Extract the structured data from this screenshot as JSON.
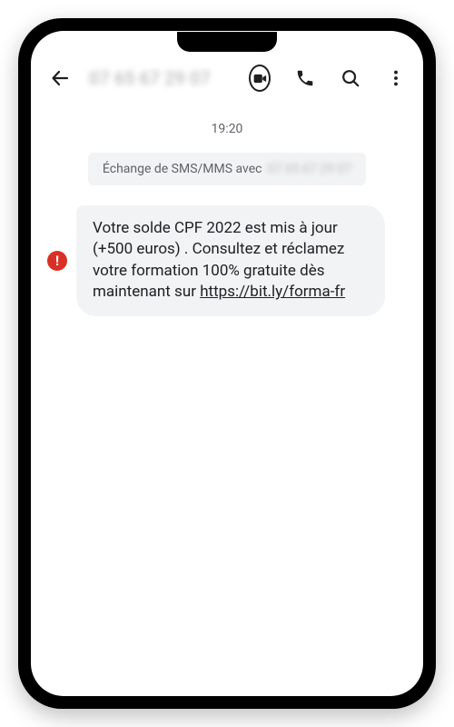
{
  "header": {
    "contact_blurred": "07 65 67 29 07"
  },
  "conversation": {
    "timestamp": "19:20",
    "exchange_prefix": "Échange de SMS/MMS avec",
    "exchange_number_blurred": "07 65 67 29 07"
  },
  "message": {
    "warning_glyph": "!",
    "body": "Votre solde CPF 2022 est mis à jour (+500 euros) . Consultez et réclamez votre formation 100% gratuite dès maintenant sur ",
    "link_text": "https://bit.ly/forma-fr"
  },
  "colors": {
    "bubble_bg": "#f1f3f4",
    "warning_bg": "#d93025",
    "text_primary": "#202124",
    "text_secondary": "#5f6368"
  }
}
